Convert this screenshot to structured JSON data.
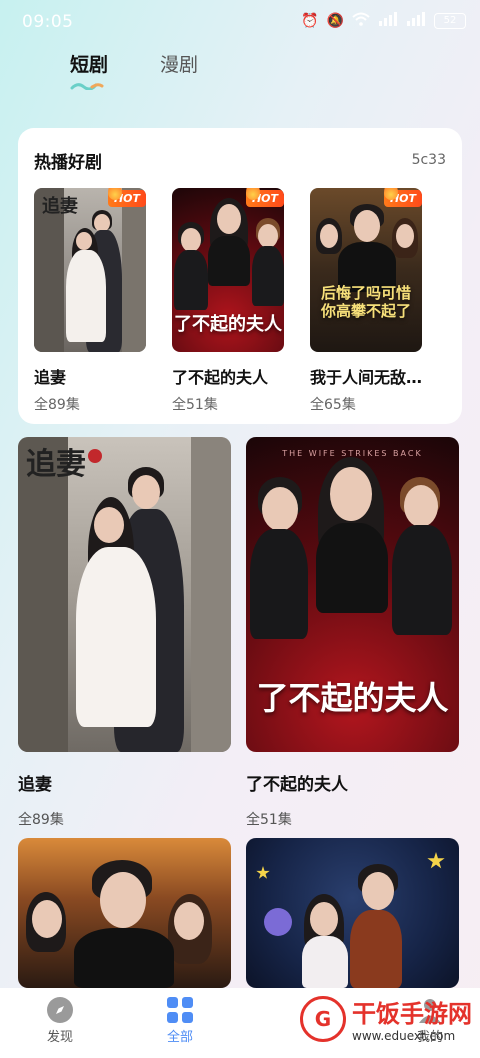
{
  "status_bar": {
    "time": "09:05",
    "battery": "52"
  },
  "top_tabs": {
    "active": "短剧",
    "inactive": "漫剧"
  },
  "hot_section": {
    "title": "热播好剧",
    "code": "5c33",
    "badge": "HOT",
    "items": [
      {
        "name": "追妻",
        "episodes": "全89集",
        "cover_text": "追妻"
      },
      {
        "name": "了不起的夫人",
        "episodes": "全51集",
        "cover_text": "了不起的夫人"
      },
      {
        "name": "我于人间无敌…",
        "episodes": "全65集",
        "cover_text": "后悔了吗可惜你高攀不起了"
      }
    ]
  },
  "grid": [
    {
      "name": "追妻",
      "episodes": "全89集",
      "cover_text": "追妻"
    },
    {
      "name": "了不起的夫人",
      "episodes": "全51集",
      "cover_text": "了不起的夫人",
      "cover_subtitle": "THE WIFE STRIKES BACK"
    },
    {
      "name": "",
      "episodes": "",
      "cover_text": ""
    },
    {
      "name": "",
      "episodes": "",
      "cover_text": ""
    }
  ],
  "bottom_nav": {
    "discover": "发现",
    "all": "全部",
    "mine": "我的"
  },
  "watermark": {
    "text": "干饭手游网",
    "url": "www.eduext.com"
  }
}
